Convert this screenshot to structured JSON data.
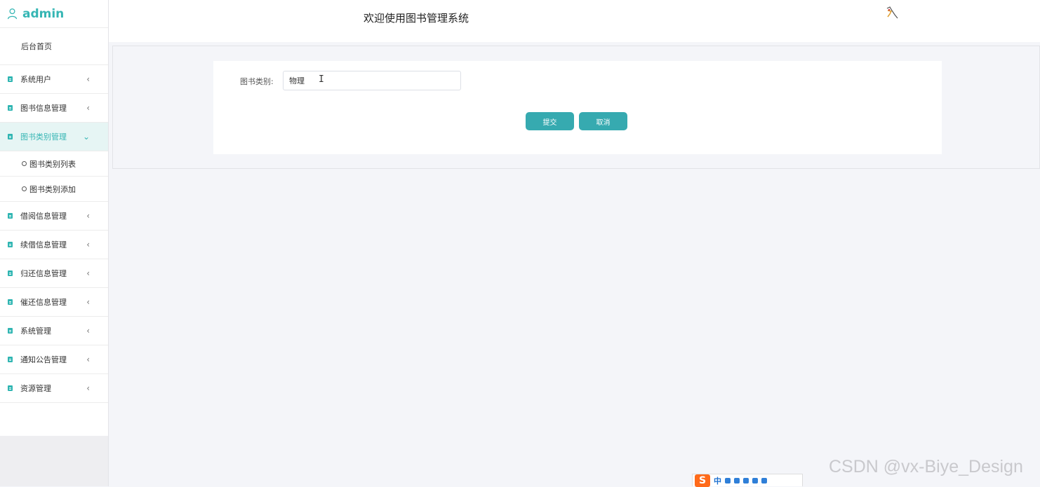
{
  "sidebar": {
    "username": "admin",
    "home": "后台首页",
    "menus": [
      {
        "label": "系统用户"
      },
      {
        "label": "图书信息管理"
      },
      {
        "label": "图书类别管理",
        "expanded": true,
        "children": [
          "图书类别列表",
          "图书类别添加"
        ]
      },
      {
        "label": "借阅信息管理"
      },
      {
        "label": "续借信息管理"
      },
      {
        "label": "归还信息管理"
      },
      {
        "label": "催还信息管理"
      },
      {
        "label": "系统管理"
      },
      {
        "label": "通知公告管理"
      },
      {
        "label": "资源管理"
      }
    ]
  },
  "header": {
    "title": "欢迎使用图书管理系统"
  },
  "form": {
    "category_label": "图书类别:",
    "category_value": "物理",
    "submit_label": "提交",
    "cancel_label": "取消"
  },
  "tray": {
    "ime_logo": "S",
    "ime_mode": "中"
  },
  "watermark": "CSDN @vx-Biye_Design",
  "colors": {
    "accent": "#36b6b4",
    "button": "#36aab0",
    "background": "#f4f5f9"
  }
}
